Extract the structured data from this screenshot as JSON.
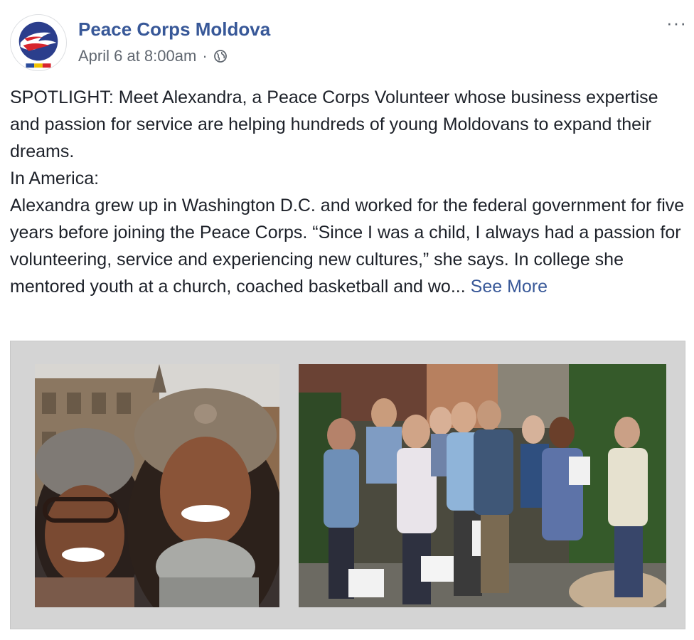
{
  "post": {
    "page_name": "Peace Corps Moldova",
    "timestamp": "April 6 at 8:00am",
    "separator": "·",
    "audience_icon": "globe-icon",
    "more_icon": "···",
    "text_lines": [
      "SPOTLIGHT: Meet Alexandra, a Peace Corps Volunteer whose business expertise and passion for service are helping hundreds of young Moldovans to expand their dreams.",
      "In America:",
      "Alexandra grew up in Washington D.C. and worked for the federal government for five years before joining the Peace Corps. “Since I was a child, I always had a passion for volunteering, service and experiencing new cultures,” she says. In college she mentored youth at a church, coached basketball and wo..."
    ],
    "see_more": "See More"
  },
  "colors": {
    "link": "#385898",
    "text": "#1d2129",
    "meta": "#606770",
    "frame": "#d4d4d4"
  }
}
